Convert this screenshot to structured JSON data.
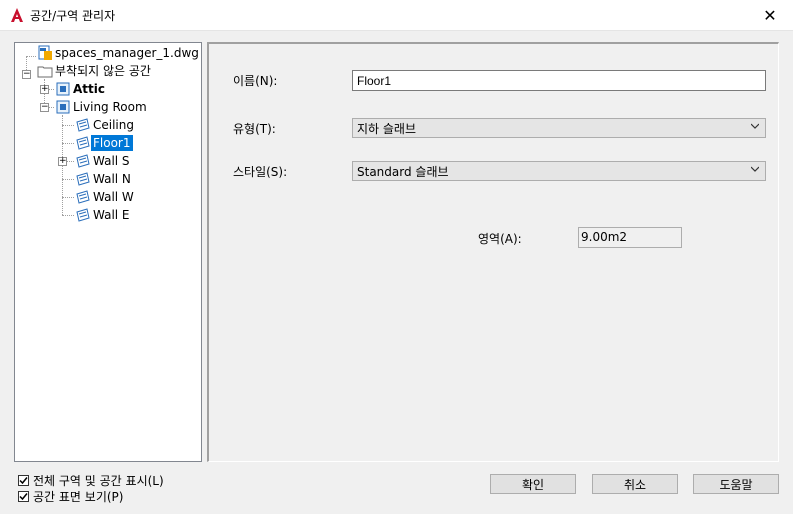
{
  "window": {
    "title": "공간/구역 관리자",
    "close_label": "✕"
  },
  "tree": {
    "root": "spaces_manager_1.dwg",
    "unattached": "부착되지 않은 공간",
    "items": [
      {
        "label": "Attic",
        "bold": true
      },
      {
        "label": "Living Room"
      },
      {
        "label": "Ceiling"
      },
      {
        "label": "Floor1",
        "selected": true
      },
      {
        "label": "Wall S"
      },
      {
        "label": "Wall N"
      },
      {
        "label": "Wall W"
      },
      {
        "label": "Wall E"
      }
    ]
  },
  "properties": {
    "name_label": "이름(N):",
    "name_value": "Floor1",
    "type_label": "유형(T):",
    "type_value": "지하 슬래브",
    "style_label": "스타일(S):",
    "style_value": "Standard 슬래브",
    "area_label": "영역(A):",
    "area_value": "9.00m2"
  },
  "options": {
    "show_all": "전체 구역 및 공간 표시(L)",
    "show_surfaces": "공간 표면 보기(P)"
  },
  "buttons": {
    "ok": "확인",
    "cancel": "취소",
    "help": "도움말"
  },
  "colors": {
    "selection": "#0078d7",
    "brand": "#c8102e"
  }
}
